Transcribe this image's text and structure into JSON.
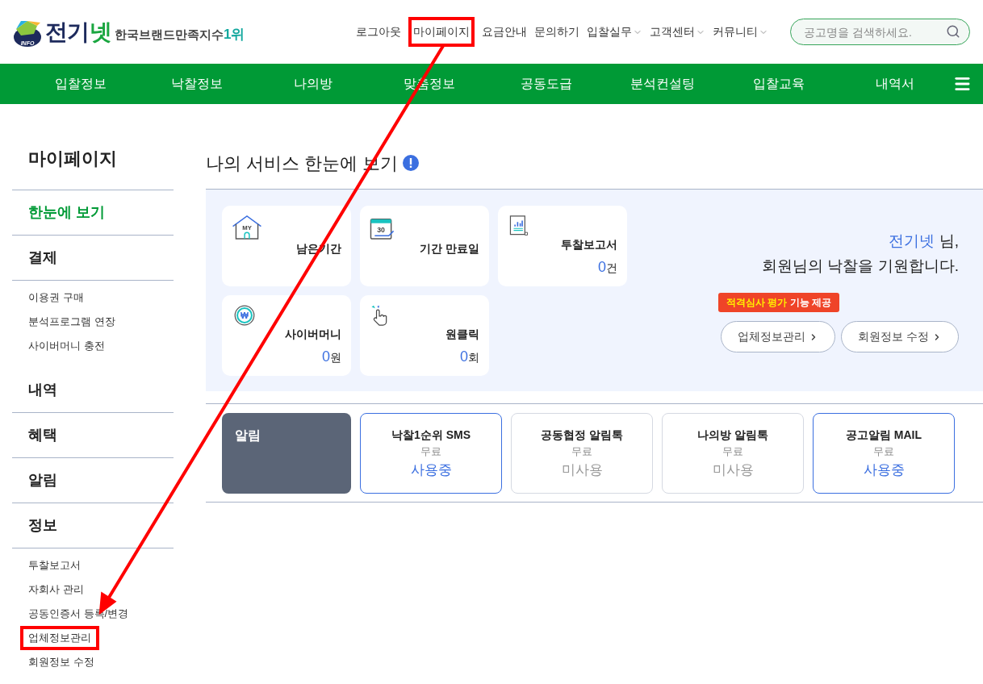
{
  "logo": {
    "badge": "INFO",
    "name_main": "전기",
    "name_accent": "넷",
    "slogan": "한국브랜드만족지수",
    "slogan_rank": "1위"
  },
  "top_links": [
    {
      "label": "로그아웃",
      "dropdown": false,
      "highlighted": false
    },
    {
      "label": "마이페이지",
      "dropdown": false,
      "highlighted": true
    },
    {
      "label": "요금안내",
      "dropdown": false,
      "highlighted": false
    },
    {
      "label": "문의하기",
      "dropdown": false,
      "highlighted": false
    },
    {
      "label": "입찰실무",
      "dropdown": true,
      "highlighted": false
    },
    {
      "label": "고객센터",
      "dropdown": true,
      "highlighted": false
    },
    {
      "label": "커뮤니티",
      "dropdown": true,
      "highlighted": false
    }
  ],
  "search": {
    "placeholder": "공고명을 검색하세요."
  },
  "main_nav": [
    "입찰정보",
    "낙찰정보",
    "나의방",
    "맞춤정보",
    "공동도급",
    "분석컨설팅",
    "입찰교육",
    "내역서"
  ],
  "sidebar": {
    "title": "마이페이지",
    "sections": [
      {
        "title": "한눈에 보기",
        "selected": true
      },
      {
        "title": "결제",
        "selected": false,
        "items": [
          {
            "label": "이용권 구매",
            "highlighted": false
          },
          {
            "label": "분석프로그램 연장",
            "highlighted": false
          },
          {
            "label": "사이버머니 충전",
            "highlighted": false
          }
        ]
      },
      {
        "title": "내역",
        "selected": false
      },
      {
        "title": "혜택",
        "selected": false
      },
      {
        "title": "알림",
        "selected": false
      },
      {
        "title": "정보",
        "selected": false,
        "items": [
          {
            "label": "투찰보고서",
            "highlighted": false
          },
          {
            "label": "자회사 관리",
            "highlighted": false
          },
          {
            "label": "공동인증서 등록/변경",
            "highlighted": false
          },
          {
            "label": "업체정보관리",
            "highlighted": true
          },
          {
            "label": "회원정보 수정",
            "highlighted": false
          }
        ]
      }
    ]
  },
  "page_title": "나의 서비스 한눈에 보기",
  "service_cards": [
    {
      "kind": "house",
      "icon_text": "MY",
      "label": "남은기간"
    },
    {
      "kind": "calendar",
      "icon_text": "30",
      "label": "기간 만료일"
    },
    {
      "kind": "report",
      "label": "투찰보고서",
      "value": "0",
      "unit": "건"
    },
    {
      "kind": "coin",
      "icon_text": "₩",
      "label": "사이버머니",
      "value": "0",
      "unit": "원"
    },
    {
      "kind": "click",
      "label": "원클릭",
      "value": "0",
      "unit": "회"
    }
  ],
  "greeting": {
    "name": "전기넷",
    "name_suffix": " 님,",
    "message": "회원님의 낙찰을 기원합니다."
  },
  "tooltip": {
    "highlight": "적격심사 평가",
    "rest": " 기능 제공"
  },
  "profile_buttons": [
    "업체정보관리",
    "회원정보 수정"
  ],
  "alerts": {
    "title": "알림",
    "items": [
      {
        "name": "낙찰1순위 SMS",
        "price": "무료",
        "status": "사용중",
        "active": true
      },
      {
        "name": "공동협정 알림톡",
        "price": "무료",
        "status": "미사용",
        "active": false
      },
      {
        "name": "나의방 알림톡",
        "price": "무료",
        "status": "미사용",
        "active": false
      },
      {
        "name": "공고알림 MAIL",
        "price": "무료",
        "status": "사용중",
        "active": true
      }
    ]
  }
}
